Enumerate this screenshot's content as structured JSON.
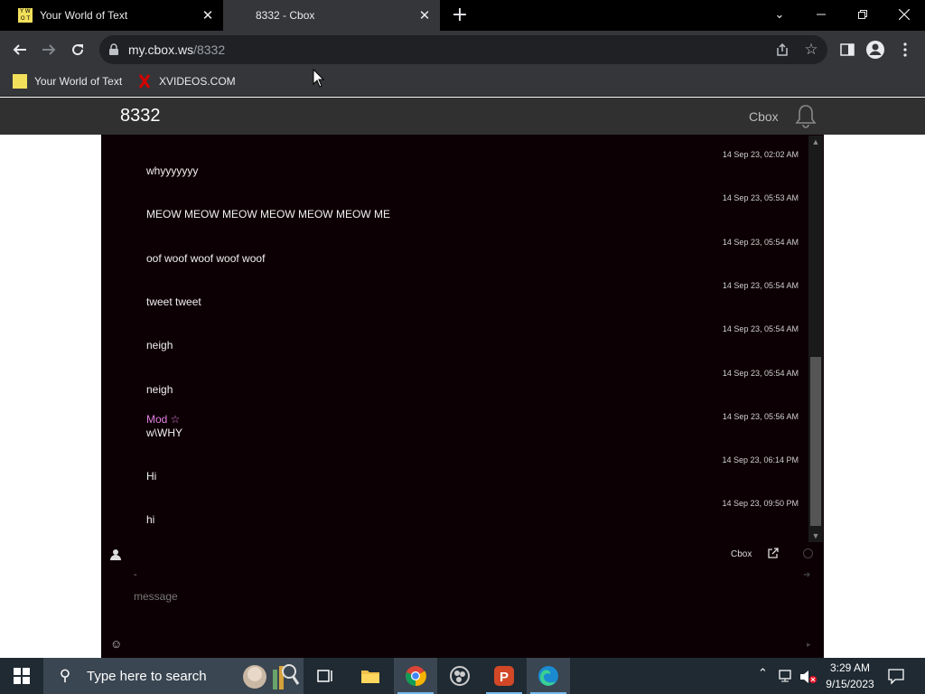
{
  "tabs": [
    {
      "title": "Your World of Text",
      "favicon": "yourworldoftext-favicon"
    },
    {
      "title": "8332 - Cbox",
      "favicon": "none"
    }
  ],
  "address": {
    "domain": "my.cbox.ws",
    "path": "/8332"
  },
  "bookmarks": [
    {
      "label": "Your World of Text",
      "favicon": "yourworldoftext-favicon"
    },
    {
      "label": "XVIDEOS.COM",
      "favicon": "x-favicon"
    }
  ],
  "cbox": {
    "room_title": "8332",
    "brand": "Cbox",
    "messages": [
      {
        "time": "14 Sep 23, 02:02 AM",
        "author": "",
        "text": "whyyyyyyy"
      },
      {
        "time": "14 Sep 23, 05:53 AM",
        "author": "",
        "text": "MEOW MEOW MEOW MEOW MEOW MEOW ME"
      },
      {
        "time": "14 Sep 23, 05:54 AM",
        "author": "",
        "text": "oof woof woof woof woof"
      },
      {
        "time": "14 Sep 23, 05:54 AM",
        "author": "",
        "text": "tweet tweet"
      },
      {
        "time": "14 Sep 23, 05:54 AM",
        "author": "",
        "text": "neigh"
      },
      {
        "time": "14 Sep 23, 05:54 AM",
        "author": "",
        "text": "neigh"
      },
      {
        "time": "14 Sep 23, 05:56 AM",
        "author": "Mod ☆",
        "text": "w\\WHY"
      },
      {
        "time": "14 Sep 23, 06:14 PM",
        "author": "",
        "text": "Hi"
      },
      {
        "time": "14 Sep 23, 09:50 PM",
        "author": "",
        "text": "hi"
      }
    ],
    "form": {
      "brand_small": "Cbox",
      "name_value": "-",
      "message_placeholder": "message"
    }
  },
  "taskbar": {
    "search_placeholder": "Type here to search",
    "time": "3:29 AM",
    "date": "9/15/2023"
  },
  "colors": {
    "chat_bg": "#0d0004",
    "mod_name": "#e080e0",
    "browser_frame": "#35363a"
  }
}
